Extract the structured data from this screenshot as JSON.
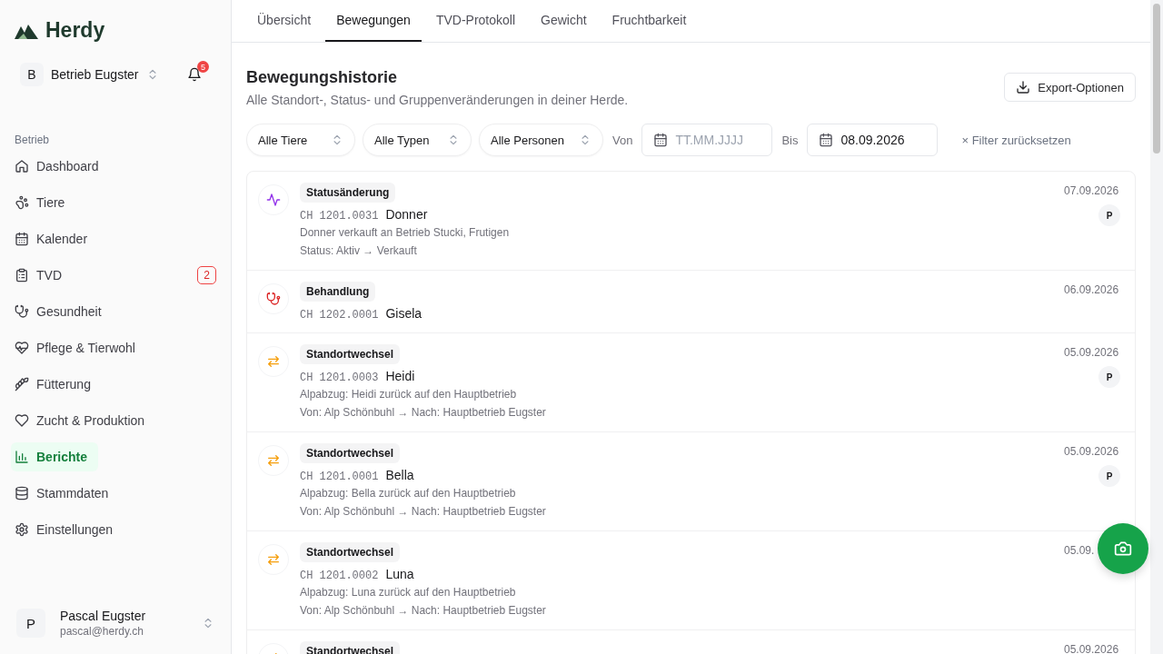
{
  "brand": {
    "name": "Herdy"
  },
  "farm": {
    "initial": "B",
    "name": "Betrieb Eugster",
    "notifications": "5"
  },
  "sidebar": {
    "section": "Betrieb",
    "items": [
      {
        "label": "Dashboard",
        "selected": false
      },
      {
        "label": "Tiere",
        "selected": false
      },
      {
        "label": "Kalender",
        "selected": false
      },
      {
        "label": "TVD",
        "selected": false,
        "badge": "2"
      },
      {
        "label": "Gesundheit",
        "selected": false
      },
      {
        "label": "Pflege & Tierwohl",
        "selected": false
      },
      {
        "label": "Fütterung",
        "selected": false
      },
      {
        "label": "Zucht & Produktion",
        "selected": false
      },
      {
        "label": "Berichte",
        "selected": true
      },
      {
        "label": "Stammdaten",
        "selected": false
      },
      {
        "label": "Einstellungen",
        "selected": false
      }
    ]
  },
  "user": {
    "initial": "P",
    "name": "Pascal Eugster",
    "email": "pascal@herdy.ch"
  },
  "tabs": [
    {
      "label": "Übersicht",
      "selected": false
    },
    {
      "label": "Bewegungen",
      "selected": true
    },
    {
      "label": "TVD-Protokoll",
      "selected": false
    },
    {
      "label": "Gewicht",
      "selected": false
    },
    {
      "label": "Fruchtbarkeit",
      "selected": false
    }
  ],
  "page": {
    "title": "Bewegungshistorie",
    "subtitle": "Alle Standort-, Status- und Gruppenveränderungen in deiner Herde.",
    "export": "Export-Optionen"
  },
  "filters": {
    "selects": [
      "Alle Tiere",
      "Alle Typen",
      "Alle Personen"
    ],
    "from_label": "Von",
    "from": {
      "placeholder": "TT.MM.JJJJ"
    },
    "to_label": "Bis",
    "to": {
      "value": "08.09.2026"
    },
    "reset": "× Filter zurücksetzen"
  },
  "events": [
    {
      "kind": "status",
      "type": "Statusänderung",
      "tag": "CH 1201.0031",
      "animal": "Donner",
      "lines": [
        "Donner verkauft an Betrieb Stucki, Frutigen",
        "Status: Aktiv → Verkauft"
      ],
      "date": "07.09.2026",
      "person": "P"
    },
    {
      "kind": "treatment",
      "type": "Behandlung",
      "tag": "CH 1202.0001",
      "animal": "Gisela",
      "date": "06.09.2026"
    },
    {
      "kind": "location",
      "type": "Standortwechsel",
      "tag": "CH 1201.0003",
      "animal": "Heidi",
      "lines": [
        "Alpabzug: Heidi zurück auf den Hauptbetrieb",
        "Von: Alp Schönbuhl → Nach: Hauptbetrieb Eugster"
      ],
      "date": "05.09.2026",
      "person": "P"
    },
    {
      "kind": "location",
      "type": "Standortwechsel",
      "tag": "CH 1201.0001",
      "animal": "Bella",
      "lines": [
        "Alpabzug: Bella zurück auf den Hauptbetrieb",
        "Von: Alp Schönbuhl → Nach: Hauptbetrieb Eugster"
      ],
      "date": "05.09.2026",
      "person": "P"
    },
    {
      "kind": "location",
      "type": "Standortwechsel",
      "tag": "CH 1201.0002",
      "animal": "Luna",
      "lines": [
        "Alpabzug: Luna zurück auf den Hauptbetrieb",
        "Von: Alp Schönbuhl → Nach: Hauptbetrieb Eugster"
      ],
      "date": "05.09."
    },
    {
      "kind": "location",
      "type": "Standortwechsel",
      "date": "05.09.2026"
    }
  ]
}
